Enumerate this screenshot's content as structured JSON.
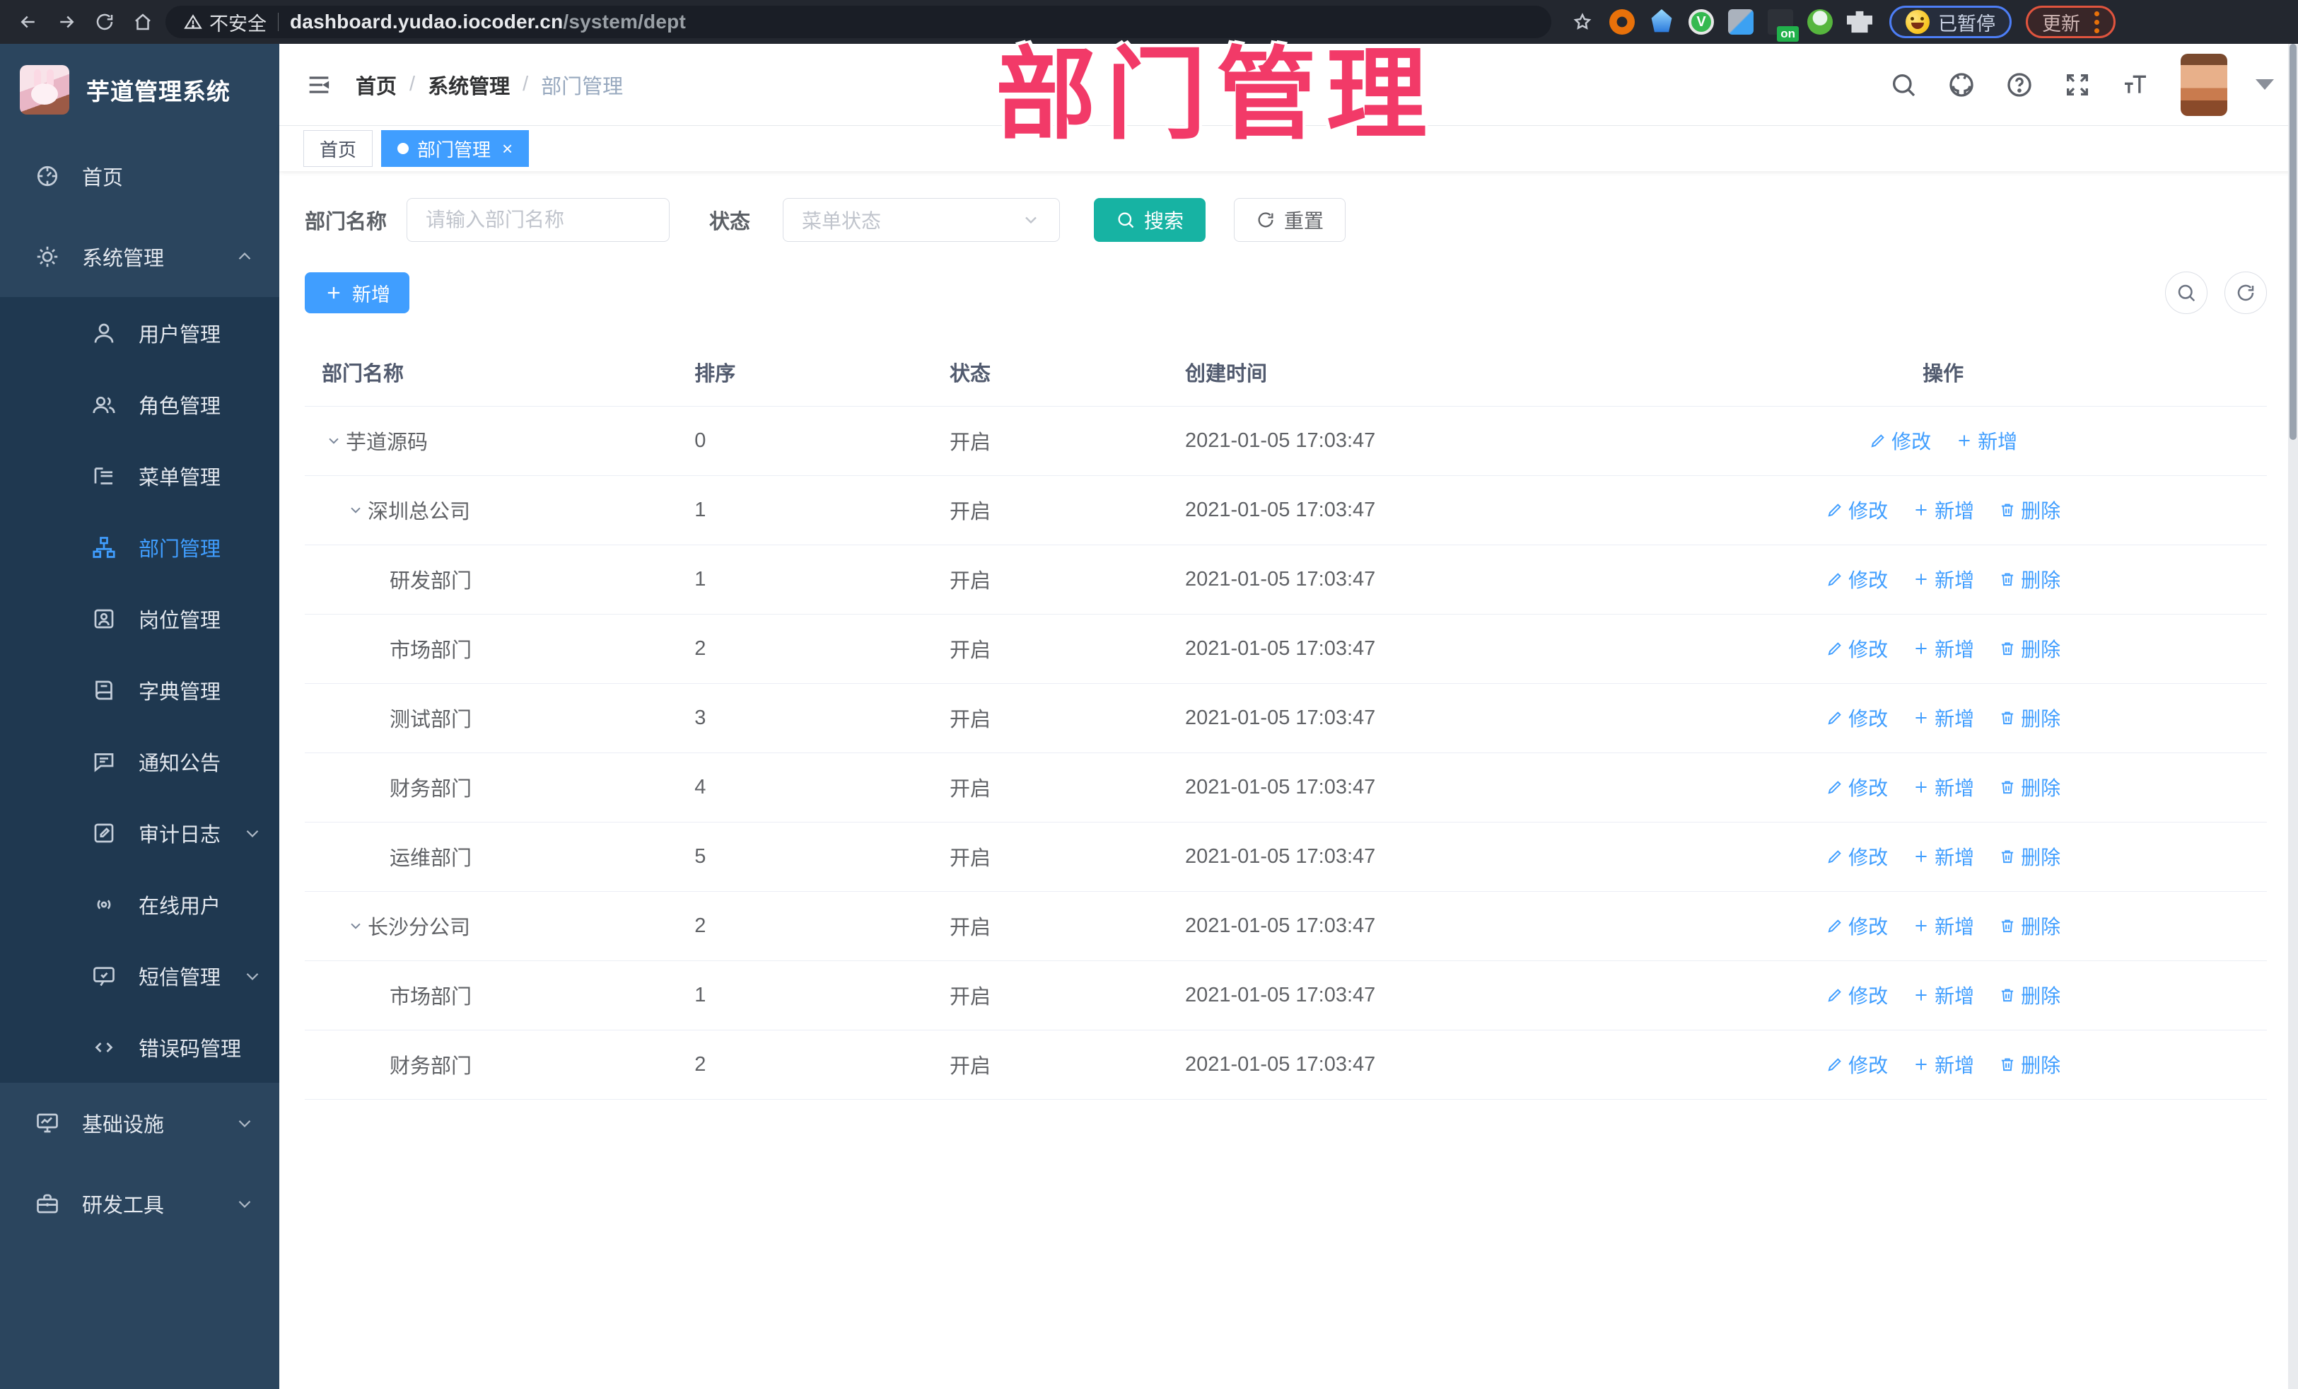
{
  "colors": {
    "accent": "#409eff",
    "search_button": "#17b3a3",
    "annotation_pink": "#f23a68",
    "sidebar_bg": "#2b455e",
    "submenu_bg": "#1f3850"
  },
  "browser": {
    "security_label": "不安全",
    "url_host": "dashboard.yudao.iocoder.cn",
    "url_path": "/system/dept",
    "paused_label": "已暂停",
    "update_label": "更新"
  },
  "overlay": {
    "title": "部门管理"
  },
  "sidebar": {
    "app_title": "芋道管理系统",
    "items": [
      {
        "id": "home",
        "label": "首页",
        "icon": "dashboard",
        "level": "root"
      },
      {
        "id": "system",
        "label": "系统管理",
        "icon": "gear",
        "level": "root",
        "chevron": "up"
      },
      {
        "id": "user-mgmt",
        "label": "用户管理",
        "icon": "user",
        "level": "sub"
      },
      {
        "id": "role-mgmt",
        "label": "角色管理",
        "icon": "users",
        "level": "sub"
      },
      {
        "id": "menu-mgmt",
        "label": "菜单管理",
        "icon": "menu-list",
        "level": "sub"
      },
      {
        "id": "dept-mgmt",
        "label": "部门管理",
        "icon": "dept-tree",
        "level": "sub",
        "active": true
      },
      {
        "id": "post-mgmt",
        "label": "岗位管理",
        "icon": "post-card",
        "level": "sub"
      },
      {
        "id": "dict-mgmt",
        "label": "字典管理",
        "icon": "dict-book",
        "level": "sub"
      },
      {
        "id": "notice",
        "label": "通知公告",
        "icon": "notice-bubble",
        "level": "sub"
      },
      {
        "id": "audit-log",
        "label": "审计日志",
        "icon": "log-edit",
        "level": "sub",
        "chevron": "down"
      },
      {
        "id": "online-user",
        "label": "在线用户",
        "icon": "online-users",
        "level": "sub"
      },
      {
        "id": "sms-mgmt",
        "label": "短信管理",
        "icon": "sms-message",
        "level": "sub",
        "chevron": "down"
      },
      {
        "id": "error-code",
        "label": "错误码管理",
        "icon": "error-code",
        "level": "sub"
      },
      {
        "id": "infra",
        "label": "基础设施",
        "icon": "infra-monitor",
        "level": "root",
        "chevron": "down"
      },
      {
        "id": "dev-tools",
        "label": "研发工具",
        "icon": "dev-tools",
        "level": "root",
        "chevron": "down"
      }
    ]
  },
  "header": {
    "breadcrumb": [
      "首页",
      "系统管理",
      "部门管理"
    ],
    "breadcrumb_separator": "/"
  },
  "tabs": [
    {
      "label": "首页",
      "active": false
    },
    {
      "label": "部门管理",
      "active": true,
      "closable": true
    }
  ],
  "filter": {
    "name_label": "部门名称",
    "name_placeholder": "请输入部门名称",
    "status_label": "状态",
    "status_placeholder": "菜单状态",
    "search_label": "搜索",
    "reset_label": "重置"
  },
  "toolbar": {
    "add_label": "新增"
  },
  "table": {
    "headers": [
      "部门名称",
      "排序",
      "状态",
      "创建时间",
      "操作"
    ],
    "action_labels": {
      "edit": "修改",
      "add": "新增",
      "delete": "删除"
    },
    "rows": [
      {
        "name": "芋道源码",
        "sort": "0",
        "status": "开启",
        "created": "2021-01-05 17:03:47",
        "level": 0,
        "caret": true,
        "actions": [
          "edit",
          "add"
        ]
      },
      {
        "name": "深圳总公司",
        "sort": "1",
        "status": "开启",
        "created": "2021-01-05 17:03:47",
        "level": 1,
        "caret": true,
        "actions": [
          "edit",
          "add",
          "delete"
        ]
      },
      {
        "name": "研发部门",
        "sort": "1",
        "status": "开启",
        "created": "2021-01-05 17:03:47",
        "level": 2,
        "caret": false,
        "actions": [
          "edit",
          "add",
          "delete"
        ]
      },
      {
        "name": "市场部门",
        "sort": "2",
        "status": "开启",
        "created": "2021-01-05 17:03:47",
        "level": 2,
        "caret": false,
        "actions": [
          "edit",
          "add",
          "delete"
        ]
      },
      {
        "name": "测试部门",
        "sort": "3",
        "status": "开启",
        "created": "2021-01-05 17:03:47",
        "level": 2,
        "caret": false,
        "actions": [
          "edit",
          "add",
          "delete"
        ]
      },
      {
        "name": "财务部门",
        "sort": "4",
        "status": "开启",
        "created": "2021-01-05 17:03:47",
        "level": 2,
        "caret": false,
        "actions": [
          "edit",
          "add",
          "delete"
        ]
      },
      {
        "name": "运维部门",
        "sort": "5",
        "status": "开启",
        "created": "2021-01-05 17:03:47",
        "level": 2,
        "caret": false,
        "actions": [
          "edit",
          "add",
          "delete"
        ]
      },
      {
        "name": "长沙分公司",
        "sort": "2",
        "status": "开启",
        "created": "2021-01-05 17:03:47",
        "level": 1,
        "caret": true,
        "actions": [
          "edit",
          "add",
          "delete"
        ]
      },
      {
        "name": "市场部门",
        "sort": "1",
        "status": "开启",
        "created": "2021-01-05 17:03:47",
        "level": 2,
        "caret": false,
        "actions": [
          "edit",
          "add",
          "delete"
        ]
      },
      {
        "name": "财务部门",
        "sort": "2",
        "status": "开启",
        "created": "2021-01-05 17:03:47",
        "level": 2,
        "caret": false,
        "actions": [
          "edit",
          "add",
          "delete"
        ]
      }
    ]
  }
}
